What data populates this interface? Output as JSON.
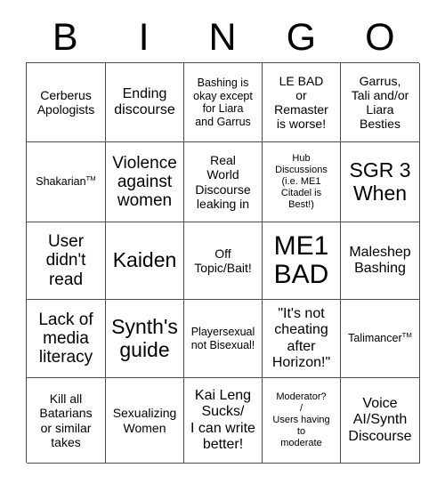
{
  "card": {
    "title": "BINGO",
    "header_letters": [
      "B",
      "I",
      "N",
      "G",
      "O"
    ],
    "grid_size": "5x5",
    "colors": {
      "background": "#ffffff",
      "text": "#000000",
      "grid_line": "#4d4d4d"
    },
    "rows": [
      [
        {
          "text": "Cerberus\nApologists",
          "size": "fs-s"
        },
        {
          "text": "Ending\ndiscourse",
          "size": "fs-m"
        },
        {
          "text": "Bashing is\nokay except\nfor Liara\nand Garrus",
          "size": "fs-xs"
        },
        {
          "text": "LE BAD\nor\nRemaster\nis worse!",
          "size": "fs-s"
        },
        {
          "text": "Garrus,\nTali and/or\nLiara\nBesties",
          "size": "fs-s"
        }
      ],
      [
        {
          "text": "Shakarian™",
          "size": "fs-xs"
        },
        {
          "text": "Violence\nagainst\nwomen",
          "size": "fs-l"
        },
        {
          "text": "Real\nWorld\nDiscourse\nleaking in",
          "size": "fs-s"
        },
        {
          "text": "Hub\nDiscussions\n(i.e. ME1\nCitadel is\nBest!)",
          "size": "fs-xxs"
        },
        {
          "text": "SGR 3\nWhen",
          "size": "fs-xl"
        }
      ],
      [
        {
          "text": "User\ndidn't\nread",
          "size": "fs-l"
        },
        {
          "text": "Kaiden",
          "size": "fs-xl"
        },
        {
          "text": "Off\nTopic/Bait!",
          "size": "fs-s"
        },
        {
          "text": "ME1\nBAD",
          "size": "fs-xxl"
        },
        {
          "text": "Maleshep\nBashing",
          "size": "fs-m"
        }
      ],
      [
        {
          "text": "Lack of\nmedia\nliteracy",
          "size": "fs-l"
        },
        {
          "text": "Synth's\nguide",
          "size": "fs-xl"
        },
        {
          "text": "Playersexual\nnot Bisexual!",
          "size": "fs-xs"
        },
        {
          "text": "\"It's not\ncheating\nafter\nHorizon!\"",
          "size": "fs-m"
        },
        {
          "text": "Talimancer™",
          "size": "fs-xs"
        }
      ],
      [
        {
          "text": "Kill all\nBatarians\nor similar\ntakes",
          "size": "fs-s"
        },
        {
          "text": "Sexualizing\nWomen",
          "size": "fs-s"
        },
        {
          "text": "Kai Leng\nSucks/\nI can write\nbetter!",
          "size": "fs-m"
        },
        {
          "text": "Moderator?\n/\nUsers having\nto\nmoderate",
          "size": "fs-xxs"
        },
        {
          "text": "Voice\nAI/Synth\nDiscourse",
          "size": "fs-m"
        }
      ]
    ]
  }
}
